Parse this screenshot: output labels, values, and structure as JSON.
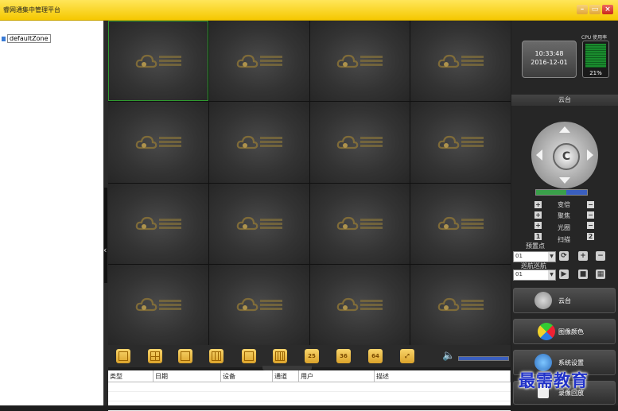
{
  "window": {
    "title": "睿网通集中管理平台",
    "min": "–",
    "max": "▭",
    "close": "×"
  },
  "tree": {
    "root_label": "defaultZone"
  },
  "video_grid": {
    "cells": 16,
    "brand_text": "睿网通"
  },
  "toolbar": {
    "layouts": [
      "1",
      "4",
      "6",
      "9",
      "13",
      "16",
      "25",
      "36",
      "64",
      "full"
    ],
    "labels": {
      "l25": "25",
      "l36": "36",
      "l64": "64"
    }
  },
  "events": {
    "columns": [
      "类型",
      "日期",
      "设备",
      "通道",
      "用户",
      "描述"
    ]
  },
  "status": {
    "time": "10:33:48",
    "date": "2016-12-01",
    "cpu_label": "CPU 使用率",
    "cpu_pct": "21%"
  },
  "ptz_panel": {
    "header": "云台",
    "rows": [
      {
        "label": "变倍"
      },
      {
        "label": "聚焦"
      },
      {
        "label": "光圈"
      },
      {
        "label": "扫描",
        "left": "1",
        "right": "2"
      }
    ],
    "preset_label": "预置点",
    "preset_value": "01",
    "cruise_label": "巡航巡航",
    "cruise_value": "01"
  },
  "buttons": {
    "ptz": "云台",
    "color": "图像颜色",
    "settings": "系统设置",
    "record": "录像回放"
  },
  "watermark": "最需教育"
}
